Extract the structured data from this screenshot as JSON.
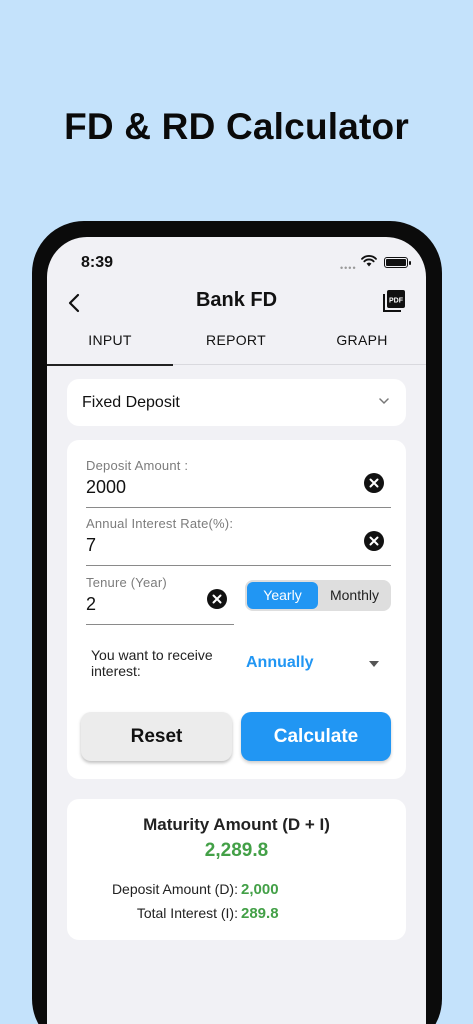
{
  "promo": {
    "headline": "FD & RD Calculator"
  },
  "status_bar": {
    "time": "8:39"
  },
  "nav": {
    "title": "Bank FD",
    "back_icon": "chevron-left-icon",
    "pdf_icon": "pdf-icon"
  },
  "tabs": [
    {
      "label": "INPUT",
      "active": true
    },
    {
      "label": "REPORT",
      "active": false
    },
    {
      "label": "GRAPH",
      "active": false
    }
  ],
  "deposit_type": {
    "selected": "Fixed Deposit"
  },
  "form": {
    "deposit_amount": {
      "label": "Deposit Amount :",
      "value": "2000"
    },
    "interest_rate": {
      "label": "Annual Interest Rate(%):",
      "value": "7"
    },
    "tenure": {
      "label": "Tenure (Year)",
      "value": "2"
    },
    "tenure_unit": {
      "options": [
        "Yearly",
        "Monthly"
      ],
      "selected": "Yearly"
    },
    "receive_interest": {
      "label": "You want to receive interest:",
      "value": "Annually"
    },
    "reset_label": "Reset",
    "calculate_label": "Calculate"
  },
  "result": {
    "title": "Maturity Amount (D + I)",
    "maturity_amount": "2,289.8",
    "deposit_label": "Deposit Amount (D):",
    "deposit_value": "2,000",
    "interest_label": "Total Interest (I):",
    "interest_value": "289.8"
  },
  "colors": {
    "background": "#c4e2fb",
    "accent": "#2196f3",
    "positive": "#43a047"
  }
}
